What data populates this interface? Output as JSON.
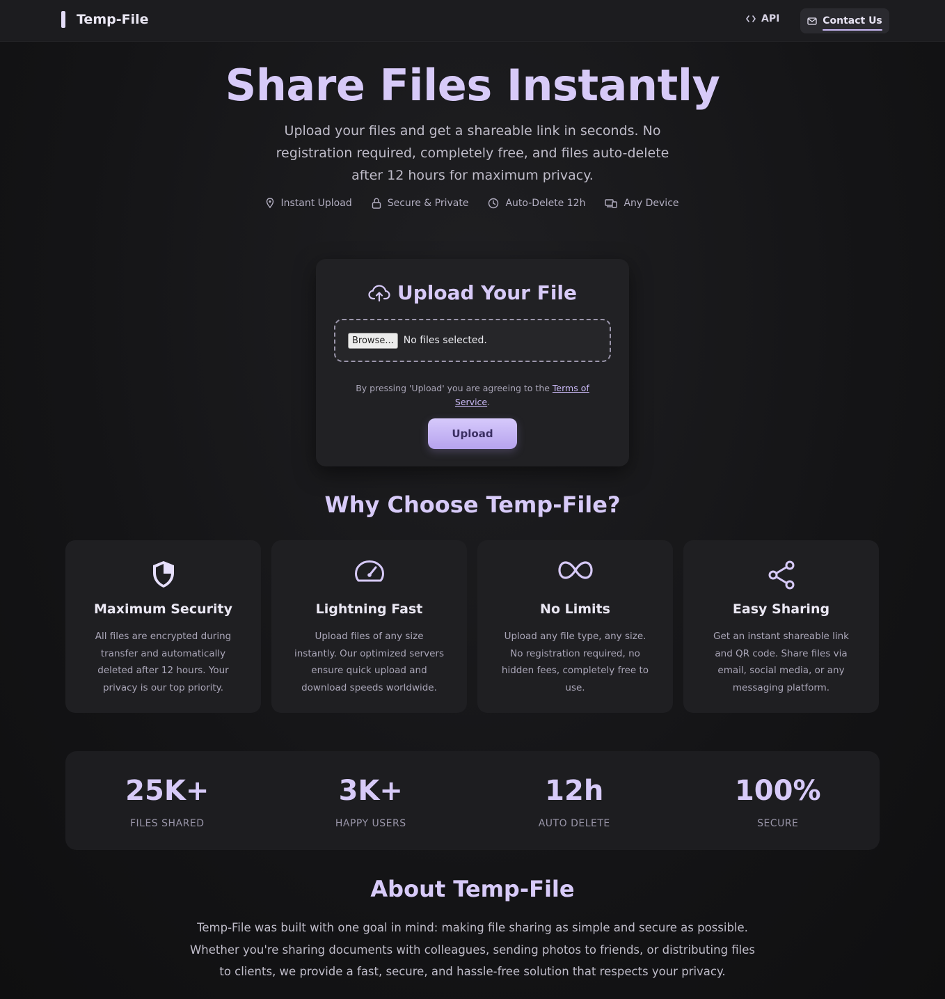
{
  "header": {
    "brand": "Temp-File",
    "nav": {
      "api_label": "API",
      "contact_label": "Contact Us"
    }
  },
  "hero": {
    "title": "Share Files Instantly",
    "subtitle": "Upload your files and get a shareable link in seconds. No registration required, completely free, and files auto-delete after 12 hours for maximum privacy.",
    "badges": [
      {
        "icon": "pin-icon",
        "label": "Instant Upload"
      },
      {
        "icon": "lock-icon",
        "label": "Secure & Private"
      },
      {
        "icon": "clock-icon",
        "label": "Auto-Delete 12h"
      },
      {
        "icon": "devices-icon",
        "label": "Any Device"
      }
    ]
  },
  "upload": {
    "title": "Upload Your File",
    "browse_label": "Browse...",
    "file_status": "No files selected.",
    "terms_prefix": "By pressing 'Upload' you are agreeing to the",
    "terms_link": "Terms of Service",
    "terms_suffix": ".",
    "button_label": "Upload"
  },
  "why": {
    "title": "Why Choose Temp-File?",
    "features": [
      {
        "icon": "shield-icon",
        "title": "Maximum Security",
        "text": "All files are encrypted during transfer and automatically deleted after 12 hours. Your privacy is our top priority."
      },
      {
        "icon": "speedometer-icon",
        "title": "Lightning Fast",
        "text": "Upload files of any size instantly. Our optimized servers ensure quick upload and download speeds worldwide."
      },
      {
        "icon": "infinity-icon",
        "title": "No Limits",
        "text": "Upload any file type, any size. No registration required, no hidden fees, completely free to use."
      },
      {
        "icon": "share-icon",
        "title": "Easy Sharing",
        "text": "Get an instant shareable link and QR code. Share files via email, social media, or any messaging platform."
      }
    ]
  },
  "stats": [
    {
      "value": "25K+",
      "label": "FILES SHARED"
    },
    {
      "value": "3K+",
      "label": "HAPPY USERS"
    },
    {
      "value": "12h",
      "label": "AUTO DELETE"
    },
    {
      "value": "100%",
      "label": "SECURE"
    }
  ],
  "about": {
    "title": "About Temp-File",
    "text": "Temp-File was built with one goal in mind: making file sharing as simple and secure as possible. Whether you're sharing documents with colleagues, sending photos to friends, or distributing files to clients, we provide a fast, secure, and hassle-free solution that respects your privacy."
  },
  "colors": {
    "accent": "#c9b8f5",
    "background": "#141416",
    "card": "#1f1f22"
  }
}
